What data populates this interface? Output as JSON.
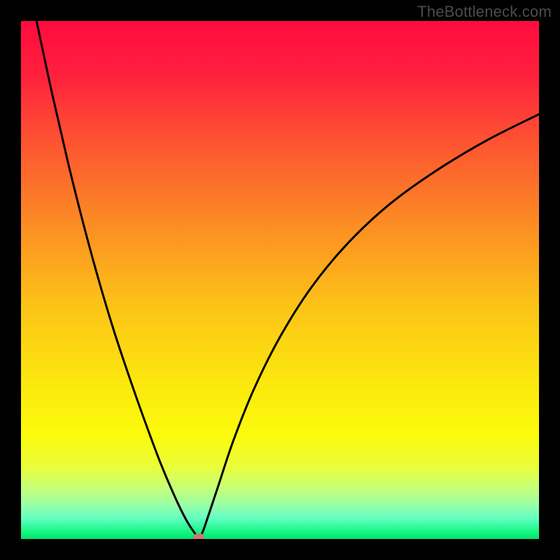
{
  "watermark": "TheBottleneck.com",
  "chart_data": {
    "type": "line",
    "title": "",
    "xlabel": "",
    "ylabel": "",
    "xlim": [
      0,
      100
    ],
    "ylim": [
      0,
      100
    ],
    "grid": false,
    "legend": "none",
    "background": {
      "kind": "vertical-gradient",
      "stops": [
        {
          "pos": 0.0,
          "color": "#ff0b3f"
        },
        {
          "pos": 0.1,
          "color": "#ff1f3d"
        },
        {
          "pos": 0.25,
          "color": "#fd5a30"
        },
        {
          "pos": 0.4,
          "color": "#fc8f23"
        },
        {
          "pos": 0.55,
          "color": "#fcc317"
        },
        {
          "pos": 0.7,
          "color": "#fbe80e"
        },
        {
          "pos": 0.8,
          "color": "#fbfb0c"
        },
        {
          "pos": 0.86,
          "color": "#eafd3a"
        },
        {
          "pos": 0.9,
          "color": "#c7ff75"
        },
        {
          "pos": 0.93,
          "color": "#a0ffa2"
        },
        {
          "pos": 0.96,
          "color": "#63ffc3"
        },
        {
          "pos": 0.985,
          "color": "#19f685"
        },
        {
          "pos": 1.0,
          "color": "#00e26d"
        }
      ]
    },
    "series": [
      {
        "name": "bottleneck-curve",
        "color": "#000000",
        "x": [
          3,
          6,
          9,
          12,
          15,
          18,
          21,
          24,
          27,
          30,
          32,
          33.5,
          34.3,
          35,
          36,
          38,
          41,
          45,
          50,
          56,
          63,
          71,
          80,
          90,
          100
        ],
        "y": [
          100,
          86,
          73,
          61,
          50,
          40,
          31,
          22.5,
          14.5,
          7.5,
          3.5,
          1.2,
          0.3,
          1.2,
          4,
          10,
          19,
          29,
          39,
          48.5,
          57,
          64.5,
          71,
          77,
          82
        ]
      }
    ],
    "marker": {
      "name": "bottleneck-marker",
      "x": 34.3,
      "y": 0.3,
      "color": "#c87a76"
    }
  }
}
